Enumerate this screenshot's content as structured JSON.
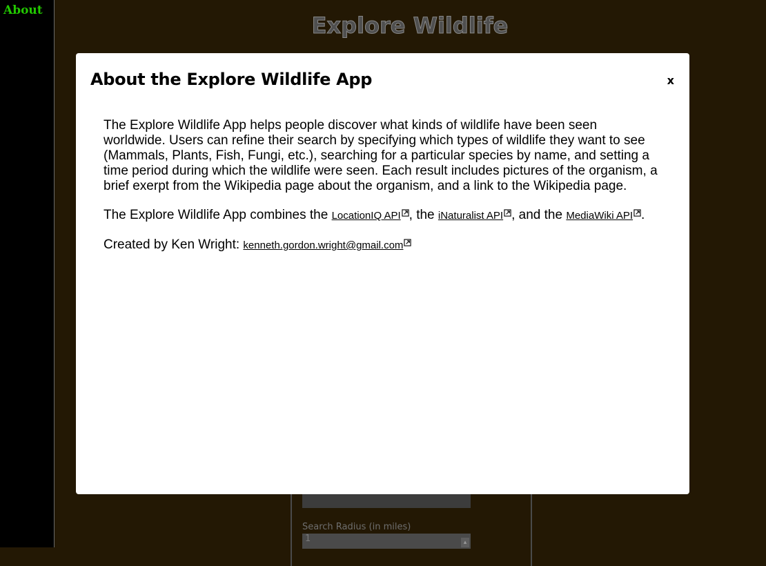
{
  "sidebar": {
    "about_label": "About"
  },
  "header": {
    "title": "Explore Wildlife"
  },
  "background_form": {
    "search_radius_label": "Search Radius (in miles)",
    "search_radius_value": "1"
  },
  "modal": {
    "title": "About the Explore Wildlife App",
    "close_label": "x",
    "paragraph1": "The Explore Wildlife App helps people discover what kinds of wildlife have been seen worldwide. Users can refine their search by specifying which types of wildlife they want to see (Mammals, Plants, Fish, Fungi, etc.), searching for a particular species by name, and setting a time period during which the wildlife were seen. Each result includes pictures of the organism, a brief exerpt from the Wikipedia page about the organism, and a link to the Wikipedia page.",
    "paragraph2": {
      "prefix": "The Explore Wildlife App combines the ",
      "link1": "LocationIQ API",
      "sep1": ", the ",
      "link2": "iNaturalist API",
      "sep2": ", and the ",
      "link3": "MediaWiki API",
      "suffix": "."
    },
    "paragraph3": {
      "prefix": "Created by Ken Wright: ",
      "email": "kenneth.gordon.wright@gmail.com"
    }
  },
  "icons": {
    "external_link": "external-link-icon"
  },
  "colors": {
    "page_background": "#231804",
    "sidebar_background": "#000000",
    "about_link": "#22c800",
    "modal_background": "#ffffff"
  }
}
